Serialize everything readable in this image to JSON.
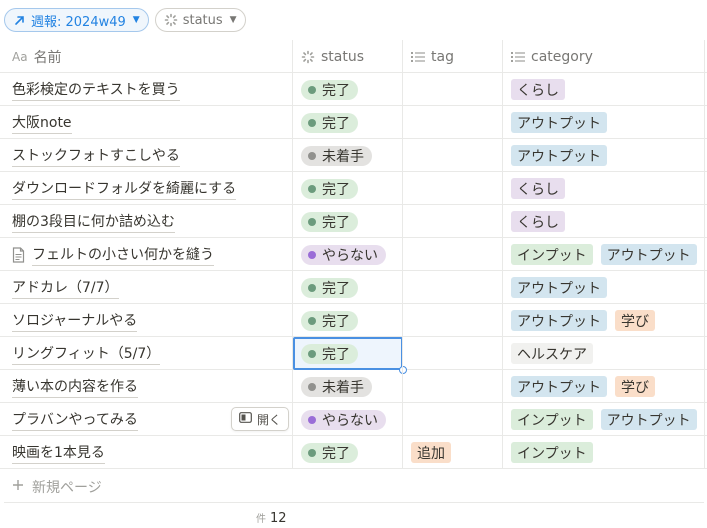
{
  "filters": {
    "view_label": "週報: 2024w49",
    "status_label": "status"
  },
  "columns": {
    "name": "名前",
    "name_prefix": "Aa",
    "status": "status",
    "tag": "tag",
    "category": "category"
  },
  "colors": {
    "done_bg": "#dbeddb",
    "done_dot": "#6c9b7d",
    "notstarted_bg": "#e3e2e0",
    "notstarted_dot": "#91918e",
    "skip_bg": "#e8deee",
    "skip_dot": "#9a6dd7",
    "kurashi": "#e8deee",
    "output": "#d3e5ef",
    "input": "#dbeddb",
    "manabi": "#fadec9",
    "health": "#f1f1ef",
    "tsuika": "#fadec9"
  },
  "rows": [
    {
      "name": "色彩検定のテキストを買う",
      "status": "完了",
      "status_kind": "done",
      "tag": "",
      "categories": [
        {
          "label": "くらし",
          "kind": "kurashi"
        }
      ]
    },
    {
      "name": "大阪note",
      "status": "完了",
      "status_kind": "done",
      "tag": "",
      "categories": [
        {
          "label": "アウトプット",
          "kind": "output"
        }
      ]
    },
    {
      "name": "ストックフォトすこしやる",
      "status": "未着手",
      "status_kind": "notstarted",
      "tag": "",
      "categories": [
        {
          "label": "アウトプット",
          "kind": "output"
        }
      ]
    },
    {
      "name": "ダウンロードフォルダを綺麗にする",
      "status": "完了",
      "status_kind": "done",
      "tag": "",
      "categories": [
        {
          "label": "くらし",
          "kind": "kurashi"
        }
      ]
    },
    {
      "name": "棚の3段目に何か詰め込む",
      "status": "完了",
      "status_kind": "done",
      "tag": "",
      "categories": [
        {
          "label": "くらし",
          "kind": "kurashi"
        }
      ]
    },
    {
      "name": "フェルトの小さい何かを縫う",
      "doc_icon": true,
      "status": "やらない",
      "status_kind": "skip",
      "tag": "",
      "categories": [
        {
          "label": "インプット",
          "kind": "input"
        },
        {
          "label": "アウトプット",
          "kind": "output"
        }
      ]
    },
    {
      "name": "アドカレ（7/7）",
      "status": "完了",
      "status_kind": "done",
      "tag": "",
      "categories": [
        {
          "label": "アウトプット",
          "kind": "output"
        }
      ]
    },
    {
      "name": "ソロジャーナルやる",
      "status": "完了",
      "status_kind": "done",
      "tag": "",
      "categories": [
        {
          "label": "アウトプット",
          "kind": "output"
        },
        {
          "label": "学び",
          "kind": "manabi"
        }
      ]
    },
    {
      "name": "リングフィット（5/7）",
      "status": "完了",
      "status_kind": "done",
      "selected": true,
      "tag": "",
      "categories": [
        {
          "label": "ヘルスケア",
          "kind": "health"
        }
      ]
    },
    {
      "name": "薄い本の内容を作る",
      "status": "未着手",
      "status_kind": "notstarted",
      "tag": "",
      "categories": [
        {
          "label": "アウトプット",
          "kind": "output"
        },
        {
          "label": "学び",
          "kind": "manabi"
        }
      ]
    },
    {
      "name": "プラバンやってみる",
      "status": "やらない",
      "status_kind": "skip",
      "hover_open": true,
      "tag": "",
      "categories": [
        {
          "label": "インプット",
          "kind": "input"
        },
        {
          "label": "アウトプット",
          "kind": "output"
        }
      ]
    },
    {
      "name": "映画を1本見る",
      "status": "完了",
      "status_kind": "done",
      "tag": "追加",
      "categories": [
        {
          "label": "インプット",
          "kind": "input"
        }
      ]
    }
  ],
  "open_button_label": "開く",
  "new_page_label": "新規ページ",
  "footer": {
    "count_label": "件",
    "count": "12"
  }
}
